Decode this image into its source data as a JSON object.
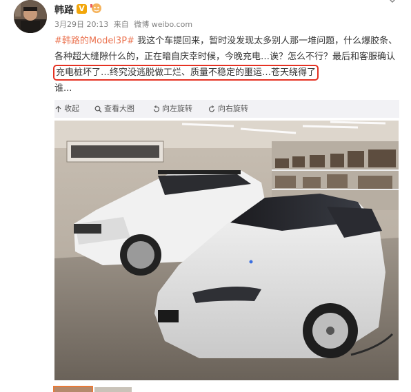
{
  "user": {
    "name": "韩路",
    "v_badge": "V",
    "post_time": "3月29日 20:13",
    "source_prefix": "来自",
    "source": "微博 weibo.com"
  },
  "post": {
    "hashtag": "#韩路的Model3P#",
    "text_main": " 我这个车提回来，暂时没发现太多别人那一堆问题，什么爆胶条、各种超大缝隙什么的，正在暗自庆幸时候，今晚充电…诶？怎么不行？最后和客服确认",
    "text_highlight": "充电桩坏了…终究没逃脱做工烂、质量不稳定的噩运…苍天绕得了",
    "text_tail": "谁..."
  },
  "actions": [
    {
      "label": "收起",
      "icon": "collapse-icon"
    },
    {
      "label": "查看大图",
      "icon": "magnify-icon"
    },
    {
      "label": "向左旋转",
      "icon": "rotate-left-icon"
    },
    {
      "label": "向右旋转",
      "icon": "rotate-right-icon"
    }
  ],
  "colors": {
    "hashtag": "#eb7350",
    "highlight_box": "#e53122",
    "action_bar_bg": "#f2f2f5"
  }
}
